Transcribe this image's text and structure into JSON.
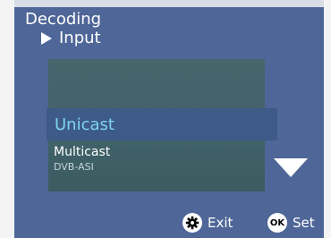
{
  "header": {
    "title": "Decoding",
    "subtitle": "Input"
  },
  "list": {
    "selected_item": "Unicast",
    "next_item": "Multicast",
    "next_item_sub": "DVB-ASI"
  },
  "footer": {
    "exit_label": "Exit",
    "set_label": "Set",
    "ok_text": "OK"
  },
  "icons": {
    "subtitle_marker": "triangle-right-icon",
    "scroll": "chevron-down-icon",
    "exit": "gear-icon",
    "set": "ok-icon"
  },
  "colors": {
    "screen_bg": "#4f6798",
    "selected_bg": "#3d5b86",
    "selected_text": "#7fd4ee",
    "text": "#ffffff"
  }
}
